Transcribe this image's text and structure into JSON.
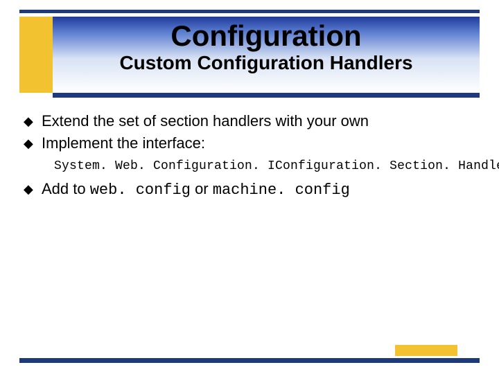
{
  "header": {
    "title": "Configuration",
    "subtitle": "Custom Configuration Handlers"
  },
  "bullets": [
    {
      "marker": "◆",
      "text": "Extend the set of section handlers with your own"
    },
    {
      "marker": "◆",
      "text": "Implement the interface:"
    }
  ],
  "code_line": "System. Web. Configuration. IConfiguration. Section. Handler",
  "bullet3": {
    "marker": "◆",
    "prefix": "Add to ",
    "code1": "web. config",
    "mid": " or ",
    "code2": "machine. config"
  },
  "colors": {
    "navy": "#1f3a7a",
    "yellow": "#f2c230"
  }
}
